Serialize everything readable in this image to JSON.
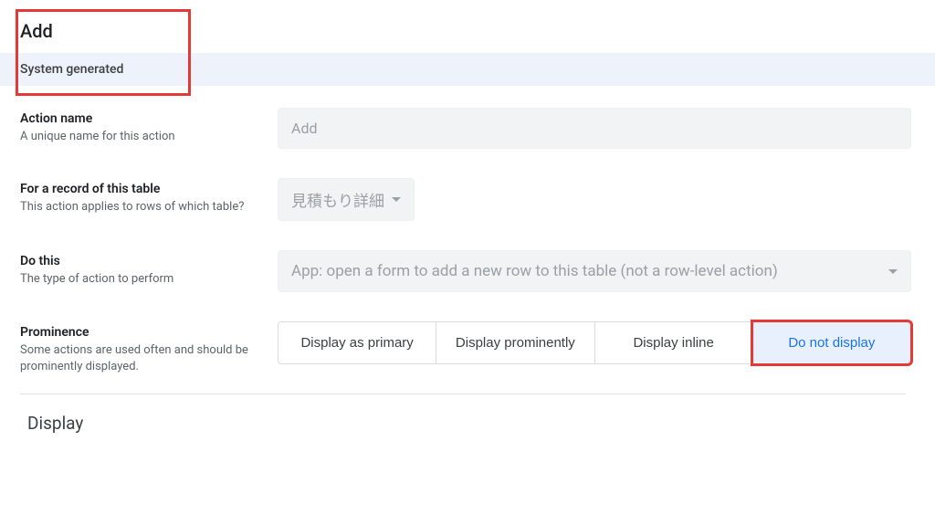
{
  "header": {
    "title": "Add",
    "subtitle": "System generated"
  },
  "fields": {
    "action_name": {
      "label": "Action name",
      "description": "A unique name for this action",
      "value": "Add"
    },
    "for_table": {
      "label": "For a record of this table",
      "description": "This action applies to rows of which table?",
      "value": "見積もり詳細"
    },
    "do_this": {
      "label": "Do this",
      "description": "The type of action to perform",
      "value": "App: open a form to add a new row to this table (not a row-level action)"
    },
    "prominence": {
      "label": "Prominence",
      "description": "Some actions are used often and should be prominently displayed.",
      "options": [
        "Display as primary",
        "Display prominently",
        "Display inline",
        "Do not display"
      ],
      "selected_index": 3
    }
  },
  "sections": {
    "display": "Display"
  }
}
